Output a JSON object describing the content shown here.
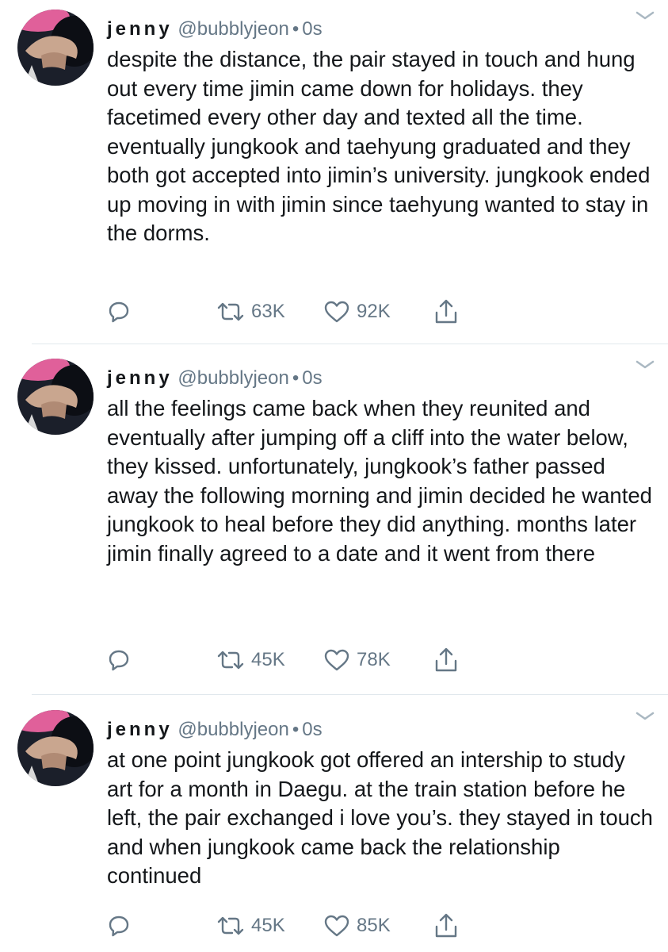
{
  "tweets": [
    {
      "name": "jenny",
      "handle": "@bubblyjeon",
      "separator": "•",
      "time": "0s",
      "text": "despite the distance, the pair stayed in touch and hung out every time jimin came down for holidays. they facetimed every other day and texted all the time. eventually jungkook and taehyung graduated and they both got accepted into jimin’s university. jungkook ended up moving in with jimin since taehyung wanted to stay in the dorms.",
      "retweets": "63K",
      "likes": "92K"
    },
    {
      "name": "jenny",
      "handle": "@bubblyjeon",
      "separator": "•",
      "time": "0s",
      "text": "all the feelings came back when they reunited and eventually after jumping off a cliff into the water below, they kissed. unfortunately, jungkook’s father passed away the following morning and jimin decided he wanted jungkook to heal before they did anything. months later jimin finally agreed to a date and it went from there",
      "retweets": "45K",
      "likes": "78K"
    },
    {
      "name": "jenny",
      "handle": "@bubblyjeon",
      "separator": "•",
      "time": "0s",
      "text": "at one point jungkook got offered an intership to study art for a month in Daegu. at the train station before he left, the pair exchanged i love you’s. they stayed in touch and when jungkook came back the relationship continued",
      "retweets": "45K",
      "likes": "85K"
    }
  ],
  "icons": {
    "reply": "reply-icon",
    "retweet": "retweet-icon",
    "like": "heart-icon",
    "share": "share-icon",
    "more": "chevron-down-icon"
  },
  "colors": {
    "text": "#14171a",
    "muted": "#657786",
    "divider": "#e1e8ed"
  }
}
